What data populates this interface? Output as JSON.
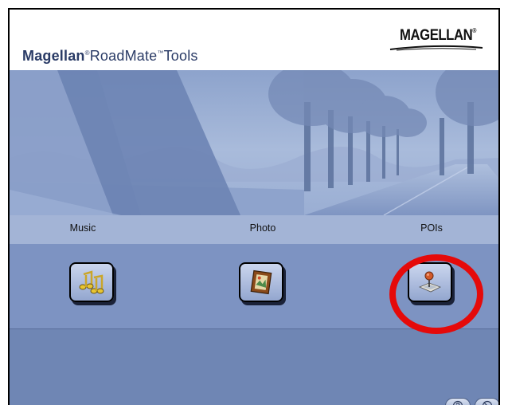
{
  "app": {
    "title_bold": "Magellan",
    "title_reg1": "RoadMate",
    "title_reg2": "Tools",
    "trademark": "®",
    "tm": "™",
    "brand": "MAGELLAN",
    "brand_mark": "®"
  },
  "tools": [
    {
      "label": "Music",
      "icon": "music-notes-icon"
    },
    {
      "label": "Photo",
      "icon": "picture-frame-icon"
    },
    {
      "label": "POIs",
      "icon": "map-pin-icon"
    }
  ],
  "footer": {
    "help_icon": "help-icon",
    "exit_icon": "exit-icon"
  },
  "colors": {
    "highlight": "#e50a0a",
    "label_bar": "#a3b4d6",
    "icon_band": "#7d93c2",
    "background": "#6f86b4"
  }
}
